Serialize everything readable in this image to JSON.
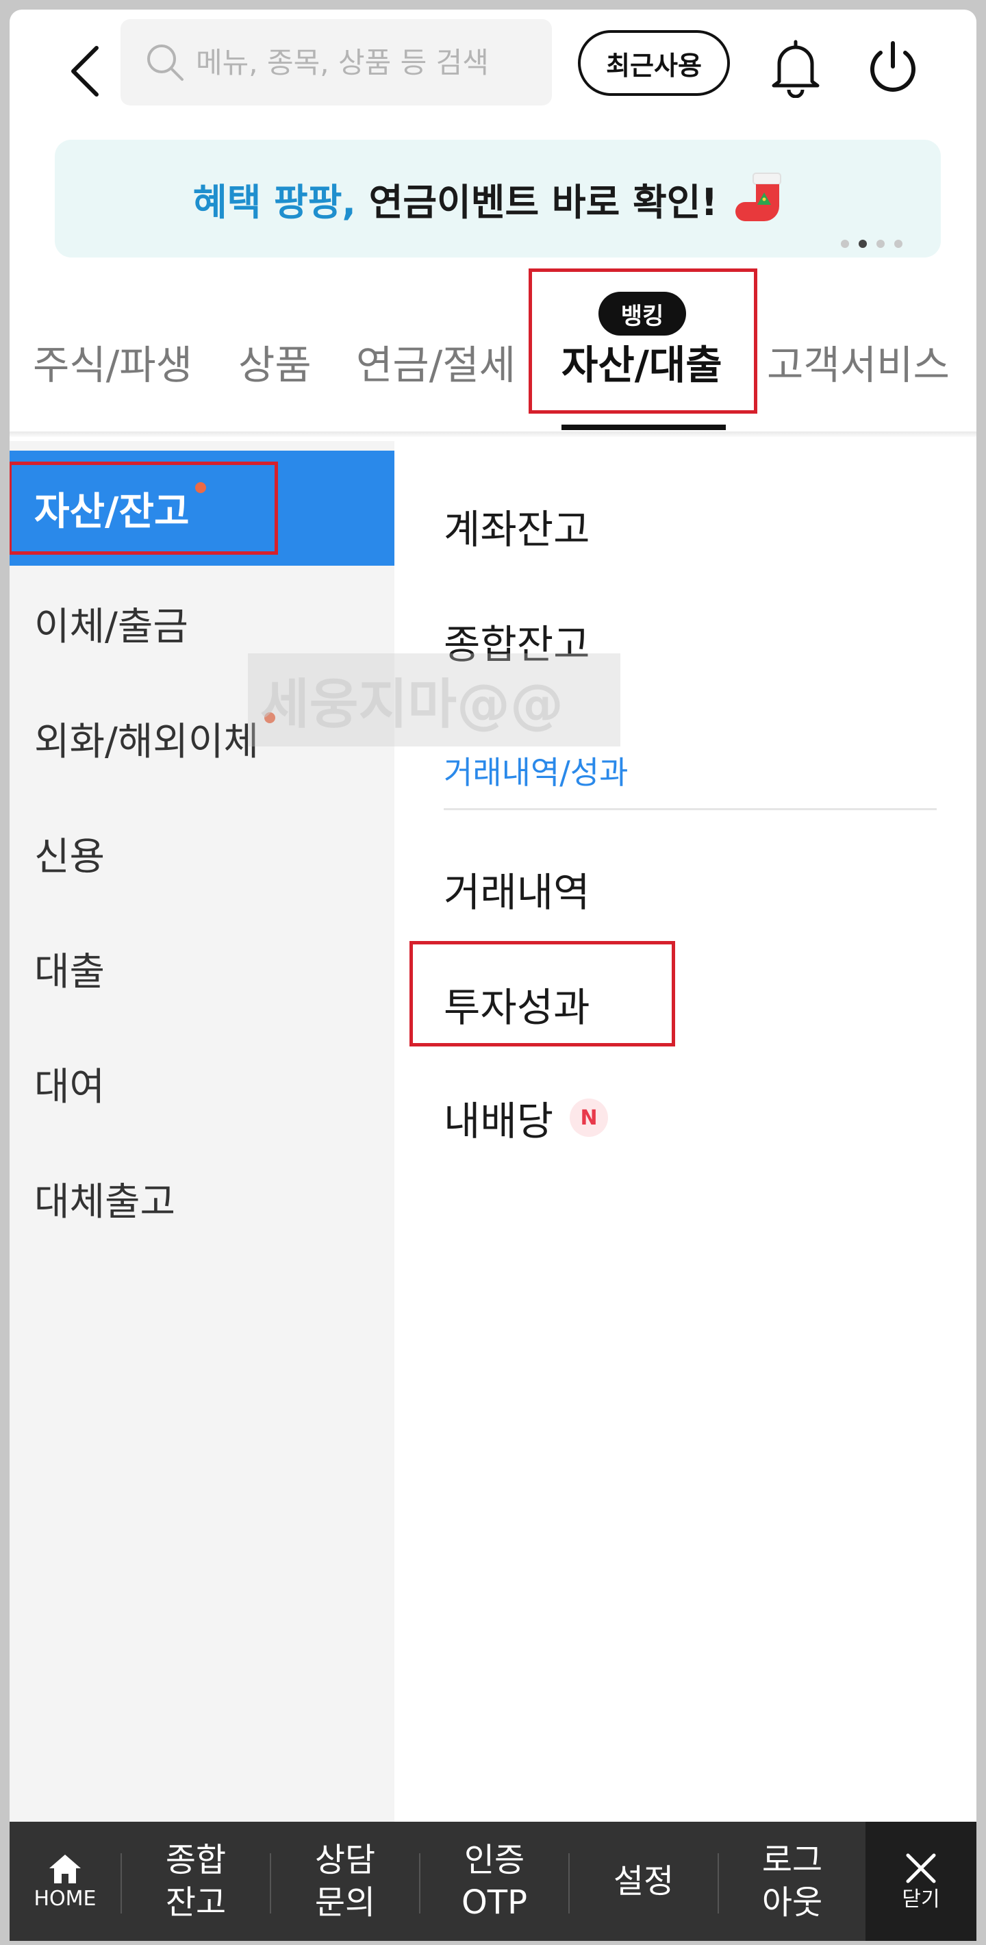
{
  "header": {
    "search_placeholder": "메뉴, 종목, 상품 등 검색",
    "recent_label": "최근사용"
  },
  "banner": {
    "highlight": "혜택 팡팡,",
    "text": " 연금이벤트 바로 확인!",
    "page_index": 2,
    "page_count": 4
  },
  "category_tabs": {
    "items": [
      "주식/파생",
      "상품",
      "연금/절세",
      "자산/대출",
      "고객서비스"
    ],
    "active": "자산/대출",
    "active_badge": "뱅킹"
  },
  "left_menu": {
    "items": [
      {
        "label": "자산/잔고",
        "active": true,
        "has_dot": true
      },
      {
        "label": "이체/출금",
        "active": false,
        "has_dot": false
      },
      {
        "label": "외화/해외이체",
        "active": false,
        "has_dot": true
      },
      {
        "label": "신용",
        "active": false,
        "has_dot": false
      },
      {
        "label": "대출",
        "active": false,
        "has_dot": false
      },
      {
        "label": "대여",
        "active": false,
        "has_dot": false
      },
      {
        "label": "대체출고",
        "active": false,
        "has_dot": false
      }
    ]
  },
  "right_menu": {
    "top_items": [
      "계좌잔고",
      "종합잔고"
    ],
    "section_title": "거래내역/성과",
    "section_items": [
      "거래내역",
      "투자성과",
      "내배당"
    ],
    "new_badge": "N"
  },
  "watermark": "세웅지마@@",
  "bottom_bar": {
    "home_label": "HOME",
    "items": [
      {
        "line1": "종합",
        "line2": "잔고"
      },
      {
        "line1": "상담",
        "line2": "문의"
      },
      {
        "line1": "인증",
        "line2": "OTP"
      },
      {
        "line1": "설정",
        "line2": ""
      },
      {
        "line1": "로그",
        "line2": "아웃"
      }
    ],
    "close_label": "닫기"
  },
  "colors": {
    "accent_blue": "#2a89ea",
    "highlight_red": "#d6202c",
    "banner_bg": "#eaf7f7",
    "bottom_bar_bg": "#333333"
  }
}
